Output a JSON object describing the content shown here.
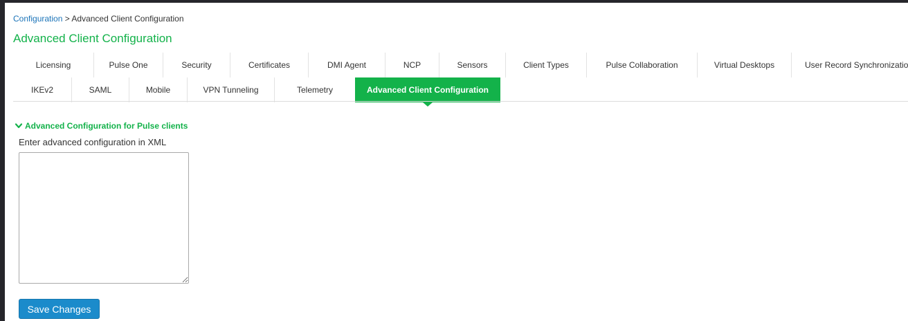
{
  "breadcrumb": {
    "root": "Configuration",
    "separator": " > ",
    "current": "Advanced Client Configuration"
  },
  "page": {
    "title": "Advanced Client Configuration"
  },
  "tabs": {
    "row1": [
      {
        "label": "Licensing"
      },
      {
        "label": "Pulse One"
      },
      {
        "label": "Security"
      },
      {
        "label": "Certificates"
      },
      {
        "label": "DMI Agent"
      },
      {
        "label": "NCP"
      },
      {
        "label": "Sensors"
      },
      {
        "label": "Client Types"
      },
      {
        "label": "Pulse Collaboration"
      },
      {
        "label": "Virtual Desktops"
      },
      {
        "label": "User Record Synchronization"
      }
    ],
    "row2": [
      {
        "label": "IKEv2"
      },
      {
        "label": "SAML"
      },
      {
        "label": "Mobile"
      },
      {
        "label": "VPN Tunneling"
      },
      {
        "label": "Telemetry"
      },
      {
        "label": "Advanced Client Configuration"
      }
    ],
    "active": "Advanced Client Configuration"
  },
  "section": {
    "title": "Advanced Configuration for Pulse clients",
    "icon": "chevron-down-icon",
    "field_label": "Enter advanced configuration in XML",
    "field_value": "",
    "field_placeholder": ""
  },
  "actions": {
    "save_label": "Save Changes"
  },
  "colors": {
    "accent_green": "#13b24a",
    "button_blue": "#1b8bcb",
    "link_blue": "#1a73b8",
    "frame": "#26262b"
  }
}
